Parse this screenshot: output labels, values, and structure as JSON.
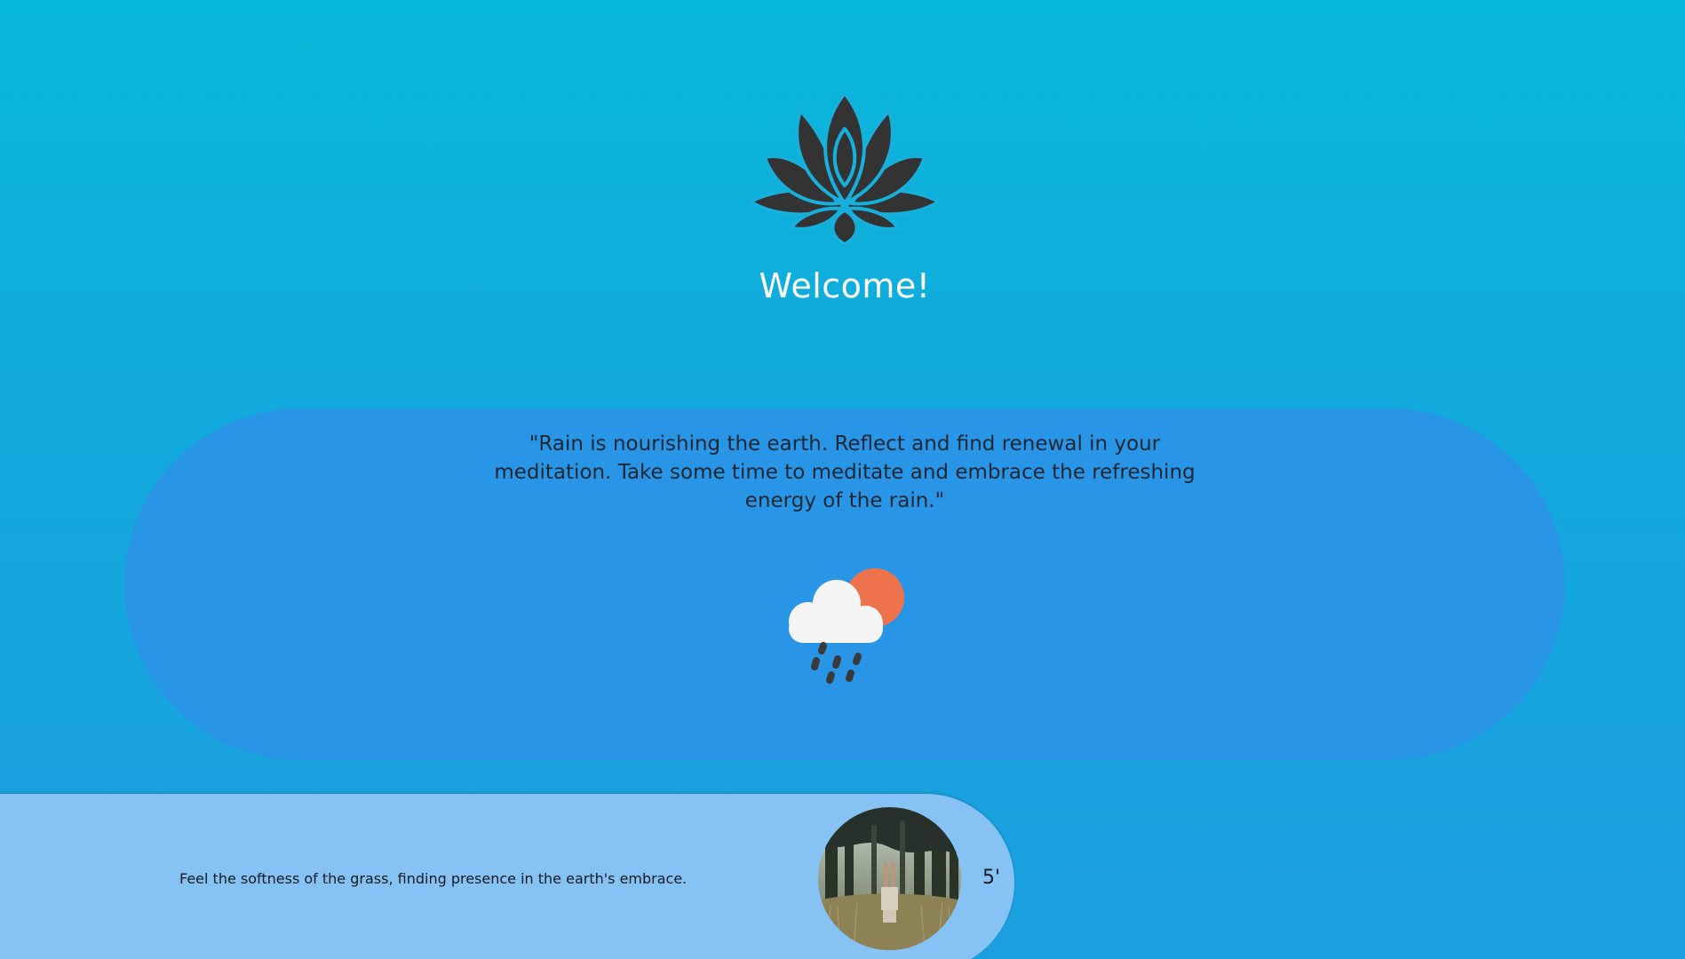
{
  "header": {
    "logo_icon": "lotus-icon",
    "welcome_text": "Welcome!"
  },
  "quote": {
    "text": "\"Rain is nourishing the earth. Reflect and find renewal in your meditation. Take some time to meditate and embrace the refreshing energy of the rain.\"",
    "weather_icon": "rain-cloud-sun-icon"
  },
  "session": {
    "description": "Feel the softness of the grass, finding presence in the earth's embrace.",
    "duration": "5'",
    "thumbnail_icon": "meditation-forest-image"
  },
  "colors": {
    "background_top": "#08b8d8",
    "background_bottom": "#1c9fe0",
    "quote_card": "#2895e6",
    "session_card": "#86c3f4",
    "lotus": "#333333",
    "sun": "#ee734d",
    "cloud": "#f5f5f5"
  }
}
